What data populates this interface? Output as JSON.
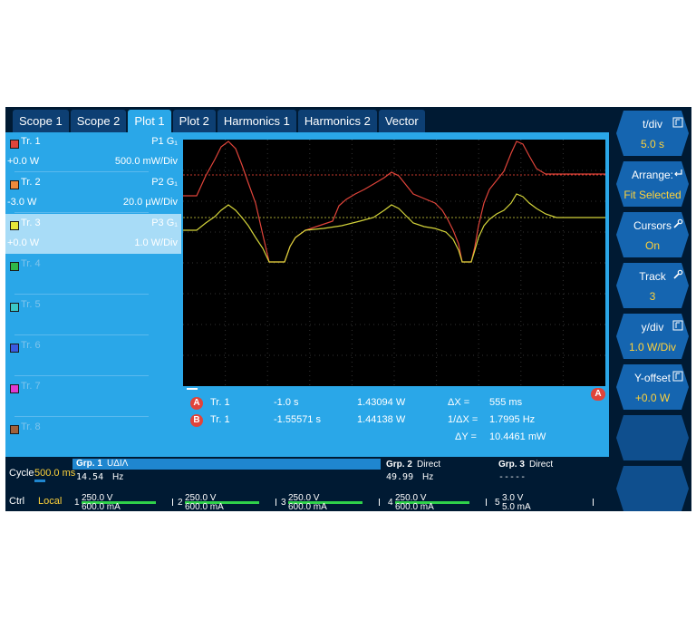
{
  "tabs": [
    {
      "label": "Scope 1",
      "active": false
    },
    {
      "label": "Scope 2",
      "active": false
    },
    {
      "label": "Plot 1",
      "active": true
    },
    {
      "label": "Plot 2",
      "active": false
    },
    {
      "label": "Harmonics 1",
      "active": false
    },
    {
      "label": "Harmonics 2",
      "active": false
    },
    {
      "label": "Vector",
      "active": false
    }
  ],
  "tracks": [
    {
      "name": "Tr. 1",
      "color": "#e0443a",
      "source": "P1 G₁",
      "value": "+0.0 W",
      "div": "500.0 mW/Div",
      "active": false,
      "enabled": true
    },
    {
      "name": "Tr. 2",
      "color": "#f08a3a",
      "source": "P2 G₁",
      "value": "-3.0 W",
      "div": "20.0 µW/Div",
      "active": false,
      "enabled": true
    },
    {
      "name": "Tr. 3",
      "color": "#e6e63a",
      "source": "P3 G₁",
      "value": "+0.0 W",
      "div": "1.0 W/Div",
      "active": true,
      "enabled": true
    },
    {
      "name": "Tr. 4",
      "color": "#2fb84a",
      "enabled": false
    },
    {
      "name": "Tr. 5",
      "color": "#3ac8c8",
      "enabled": false
    },
    {
      "name": "Tr. 6",
      "color": "#3a5ae0",
      "enabled": false
    },
    {
      "name": "Tr. 7",
      "color": "#e03ad0",
      "enabled": false
    },
    {
      "name": "Tr. 8",
      "color": "#a0603a",
      "enabled": false
    }
  ],
  "cursors": {
    "a": {
      "badge": "A",
      "track": "Tr. 1",
      "time": "-1.0 s",
      "value": "1.43094 W",
      "delta_label": "ΔX =",
      "delta_value": "555 ms"
    },
    "b": {
      "badge": "B",
      "track": "Tr. 1",
      "time": "-1.55571 s",
      "value": "1.44138 W",
      "delta_label": "1/ΔX =",
      "delta_value": "1.7995 Hz"
    },
    "dy_label": "ΔY =",
    "dy_value": "10.4461 mW",
    "plot_marker": "A"
  },
  "softkeys": [
    {
      "label": "t/div",
      "value": "5.0 s",
      "icon": "scale-icon"
    },
    {
      "label": "Arrange:",
      "value": "Fit Selected",
      "icon": "return-icon"
    },
    {
      "label": "Cursors",
      "value": "On",
      "icon": "wrench-icon"
    },
    {
      "label": "Track",
      "value": "3",
      "icon": "wrench-icon"
    },
    {
      "label": "y/div",
      "value": "1.0 W/Div",
      "icon": "scale-icon"
    },
    {
      "label": "Y-offset",
      "value": "+0.0 W",
      "icon": "scale-icon"
    },
    {
      "label": "",
      "value": ""
    },
    {
      "label": "",
      "value": ""
    }
  ],
  "status": {
    "cycle_label": "Cycle",
    "cycle_value": "500.0 ms",
    "ctrl_label": "Ctrl",
    "ctrl_value": "Local",
    "groups": [
      {
        "name": "Grp. 1",
        "mode": "UΔIΛ",
        "freq": "14.54",
        "unit": "Hz"
      },
      {
        "name": "Grp. 2",
        "mode": "Direct",
        "freq": "49.99",
        "unit": "Hz"
      },
      {
        "name": "Grp. 3",
        "mode": "Direct",
        "freq": "-----",
        "unit": ""
      }
    ],
    "channels": [
      {
        "num": "1",
        "voltage": "250.0 V",
        "current": "600.0 mA",
        "level": 0.82
      },
      {
        "num": "2",
        "voltage": "250.0 V",
        "current": "600.0 mA",
        "level": 0.82
      },
      {
        "num": "3",
        "voltage": "250.0 V",
        "current": "600.0 mA",
        "level": 0.82
      },
      {
        "num": "4",
        "voltage": "250.0 V",
        "current": "600.0 mA",
        "level": 0.82
      },
      {
        "num": "5",
        "voltage": "3.0 V",
        "current": "5.0 mA",
        "level": 0.0
      }
    ]
  },
  "colors": {
    "screen_bg": "#001a33",
    "panel_blue": "#2aa7e8",
    "accent_yellow": "#ffd23a",
    "trace_red": "#e0443a",
    "trace_yellow": "#d4d43a"
  }
}
